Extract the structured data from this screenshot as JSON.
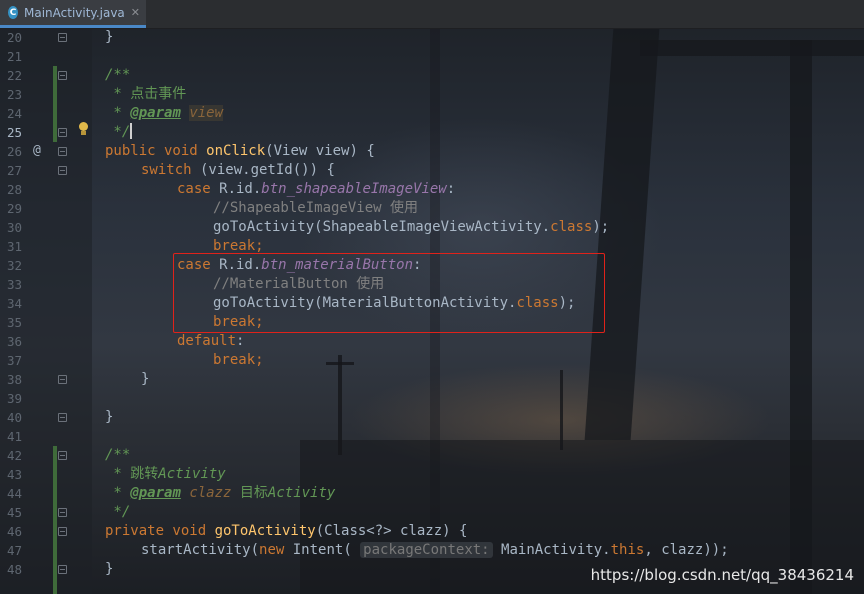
{
  "tab": {
    "icon_letter": "C",
    "label": "MainActivity.java",
    "close": "✕"
  },
  "gutter": {
    "line_numbers": [
      "20",
      "21",
      "22",
      "23",
      "24",
      "25",
      "26",
      "27",
      "28",
      "29",
      "30",
      "31",
      "32",
      "33",
      "34",
      "35",
      "36",
      "37",
      "38",
      "39",
      "40",
      "41",
      "42",
      "43",
      "44",
      "45",
      "46",
      "47",
      "48"
    ],
    "current_line": "25",
    "override_marker": "@"
  },
  "code": {
    "l20": "}",
    "l22": "/**",
    "l23_star": " * ",
    "l23_text": "点击事件",
    "l24_star": " * ",
    "l24_tag": "@param",
    "l24_param": "view",
    "l25": " */",
    "l26_kw": "public void ",
    "l26_fn": "onClick",
    "l26_rest": "(View view) {",
    "l27_kw": "switch",
    "l27_rest": " (view.getId()) {",
    "l28_kw": "case",
    "l28_mid": " R.id.",
    "l28_field": "btn_shapeableImageView",
    "l28_end": ":",
    "l29": "//ShapeableImageView 使用",
    "l30_a": "goToActivity(ShapeableImageViewActivity.",
    "l30_kw": "class",
    "l30_b": ");",
    "l31": "break;",
    "l32_kw": "case",
    "l32_mid": " R.id.",
    "l32_field": "btn_materialButton",
    "l32_end": ":",
    "l33": "//MaterialButton 使用",
    "l34_a": "goToActivity(MaterialButtonActivity.",
    "l34_kw": "class",
    "l34_b": ");",
    "l35": "break;",
    "l36": "default",
    "l36_end": ":",
    "l37": "break;",
    "l38": "}",
    "l40": "}",
    "l42": "/**",
    "l43_star": " * ",
    "l43_text": "跳转",
    "l43_italic": "Activity",
    "l44_star": " * ",
    "l44_tag": "@param",
    "l44_param": "clazz",
    "l44_text": " 目标",
    "l44_italic": "Activity",
    "l45": " */",
    "l46_kw": "private void ",
    "l46_fn": "goToActivity",
    "l46_rest": "(Class<?> clazz) {",
    "l47_a": "startActivity(",
    "l47_kw": "new",
    "l47_b": " Intent( ",
    "l47_hint": "packageContext:",
    "l47_c": " MainActivity.",
    "l47_this": "this",
    "l47_d": ", clazz));",
    "l48": "}"
  },
  "watermark": "https://blog.csdn.net/qq_38436214",
  "colors": {
    "keyword": "#cc7832",
    "function": "#ffc66d",
    "comment": "#808080",
    "doc": "#629755",
    "field": "#9876aa",
    "text": "#a9b7c6",
    "highlight_box": "#e0221a"
  }
}
